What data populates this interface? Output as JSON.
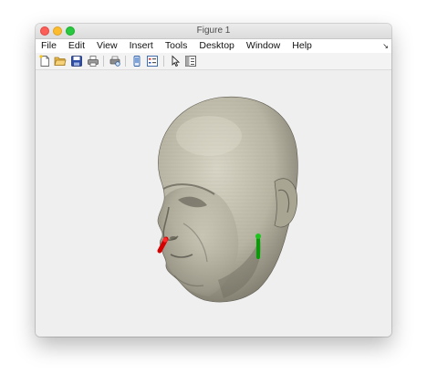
{
  "window": {
    "title": "Figure 1"
  },
  "menubar": {
    "items": [
      "File",
      "Edit",
      "View",
      "Insert",
      "Tools",
      "Desktop",
      "Window",
      "Help"
    ],
    "dock_icon": "undock-arrow-icon"
  },
  "toolbar": {
    "buttons": [
      "new-figure-icon",
      "open-file-icon",
      "save-icon",
      "print-icon",
      "print-preview-icon",
      "link-plot-icon",
      "insert-legend-icon",
      "pointer-icon",
      "property-editor-icon"
    ]
  },
  "figure": {
    "content": "3d-head-surface",
    "surface_color": "#bdb9a8",
    "background_color": "#efefef",
    "markers": [
      {
        "name": "red-marker",
        "color": "#d40000"
      },
      {
        "name": "green-marker",
        "color": "#00a000"
      }
    ]
  }
}
